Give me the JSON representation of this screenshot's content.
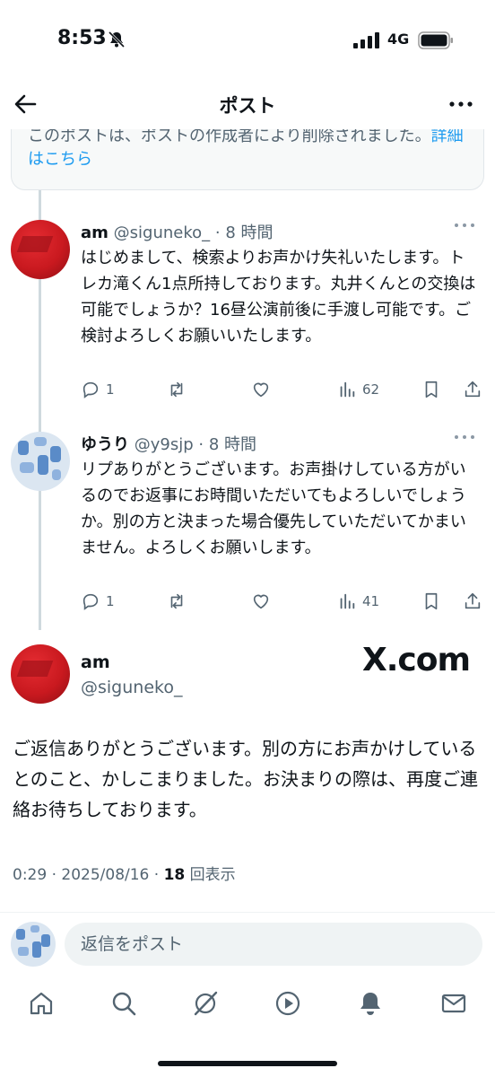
{
  "status": {
    "time": "8:53",
    "network": "4G"
  },
  "header": {
    "title": "ポスト"
  },
  "deleted_card": {
    "text": "このポストは、ポストの作成者により削除されました。",
    "link": "詳細はこちら"
  },
  "replies": [
    {
      "name": "am",
      "handle": "@siguneko_",
      "time": "· 8 時間",
      "text": "はじめまして、検索よりお声かけ失礼いたします。トレカ滝くん1点所持しております。丸井くんとの交換は可能でしょうか？16昼公演前後に手渡し可能です。ご検討よろしくお願いいたします。",
      "reply_count": "1",
      "views": "62"
    },
    {
      "name": "ゆうり",
      "handle": "@y9sjp",
      "time": "· 8 時間",
      "text": "リプありがとうございます。お声掛けしている方がいるのでお返事にお時間いただいてもよろしいでしょうか。別の方と決まった場合優先していただいてかまいません。よろしくお願いします。",
      "reply_count": "1",
      "views": "41"
    }
  ],
  "main_post": {
    "name": "am",
    "handle": "@siguneko_",
    "watermark": "X.com",
    "text": "ご返信ありがとうございます。別の方にお声かけしているとのこと、かしこまりました。お決まりの際は、再度ご連絡お待ちしております。",
    "timestamp": "0:29 · 2025/08/16 · ",
    "views": "18",
    "views_label": " 回表示"
  },
  "reply_bar": {
    "placeholder": "返信をポスト"
  },
  "colors": {
    "accent": "#1d9bf0",
    "text": "#0f1419",
    "muted": "#536471"
  },
  "nav_icons": [
    "home-icon",
    "search-icon",
    "grok-icon",
    "video-icon",
    "notifications-icon",
    "messages-icon"
  ]
}
